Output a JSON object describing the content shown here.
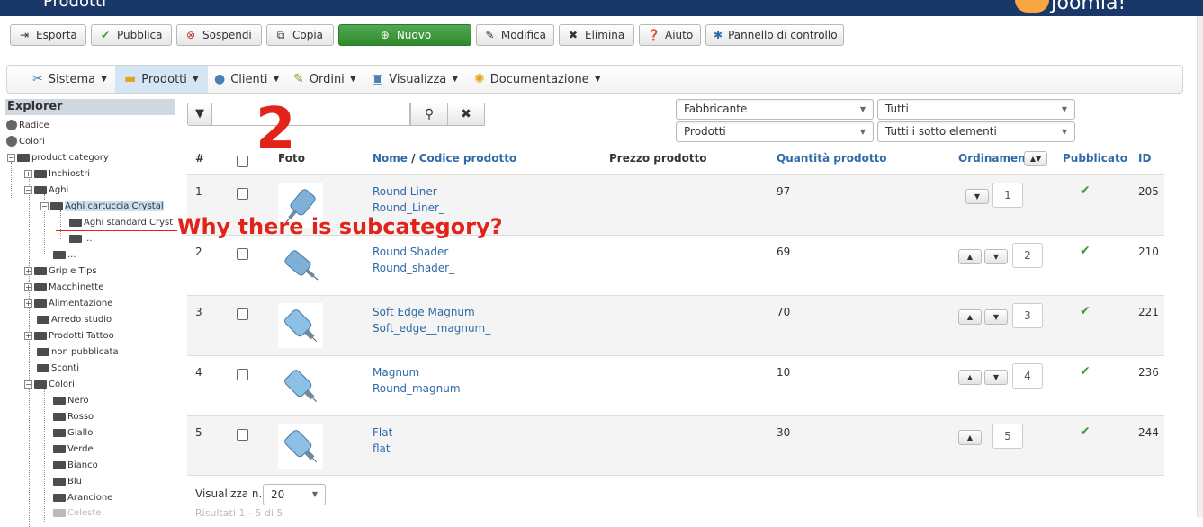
{
  "header": {
    "title": "Prodotti",
    "brand": "Joomla!"
  },
  "toolbar": {
    "esporta": "Esporta",
    "pubblica": "Pubblica",
    "sospendi": "Sospendi",
    "copia": "Copia",
    "nuovo": "Nuovo",
    "modifica": "Modifica",
    "elimina": "Elimina",
    "aiuto": "Aiuto",
    "pannello": "Pannello di controllo"
  },
  "menu": [
    "Sistema",
    "Prodotti",
    "Clienti",
    "Ordini",
    "Visualizza",
    "Documentazione"
  ],
  "explorer": {
    "title": "Explorer",
    "items": [
      "Radice",
      "Colori",
      "product category",
      "Inchiostri",
      "Aghi",
      "Aghi cartuccia Crystal",
      "Aghi standard Cryst",
      "...",
      "...",
      "Grip e Tips",
      "Macchinette",
      "Alimentazione",
      "Arredo studio",
      "Prodotti Tattoo",
      "non pubblicata",
      "Sconti",
      "Colori",
      "Nero",
      "Rosso",
      "Giallo",
      "Verde",
      "Bianco",
      "Blu",
      "Arancione",
      "Celeste"
    ]
  },
  "search": {
    "value": "",
    "placeholder": ""
  },
  "filters": {
    "manufacturer": "Fabbricante",
    "type": "Prodotti",
    "all": "Tutti",
    "sub": "Tutti i sotto elementi"
  },
  "table": {
    "headers": {
      "num": "#",
      "foto": "Foto",
      "nome": "Nome",
      "sep": " / ",
      "codice": "Codice prodotto",
      "prezzo": "Prezzo prodotto",
      "quantita": "Quantità prodotto",
      "ordinamento": "Ordinamento",
      "pubblicato": "Pubblicato",
      "id": "ID"
    },
    "rows": [
      {
        "num": "1",
        "name": "Round Liner",
        "code": "Round_Liner_",
        "qty": "97",
        "order": "1",
        "id": "205"
      },
      {
        "num": "2",
        "name": "Round Shader",
        "code": "Round_shader_",
        "qty": "69",
        "order": "2",
        "id": "210"
      },
      {
        "num": "3",
        "name": "Soft Edge Magnum",
        "code": "Soft_edge__magnum_",
        "qty": "70",
        "order": "3",
        "id": "221"
      },
      {
        "num": "4",
        "name": "Magnum",
        "code": "Round_magnum",
        "qty": "10",
        "order": "4",
        "id": "236"
      },
      {
        "num": "5",
        "name": "Flat",
        "code": "flat",
        "qty": "30",
        "order": "5",
        "id": "244"
      }
    ]
  },
  "annotation": {
    "number": "2",
    "question": "Why there is subcategory?"
  },
  "footer": {
    "label": "Visualizza n.",
    "per_page": "20",
    "results": "Risultati 1 - 5 di 5"
  },
  "colors": {
    "topbar": "#1a3867",
    "link": "#2f6ba8",
    "annotation": "#e2231a",
    "check": "#3c9a3a",
    "nuovo": "#3b9438"
  }
}
